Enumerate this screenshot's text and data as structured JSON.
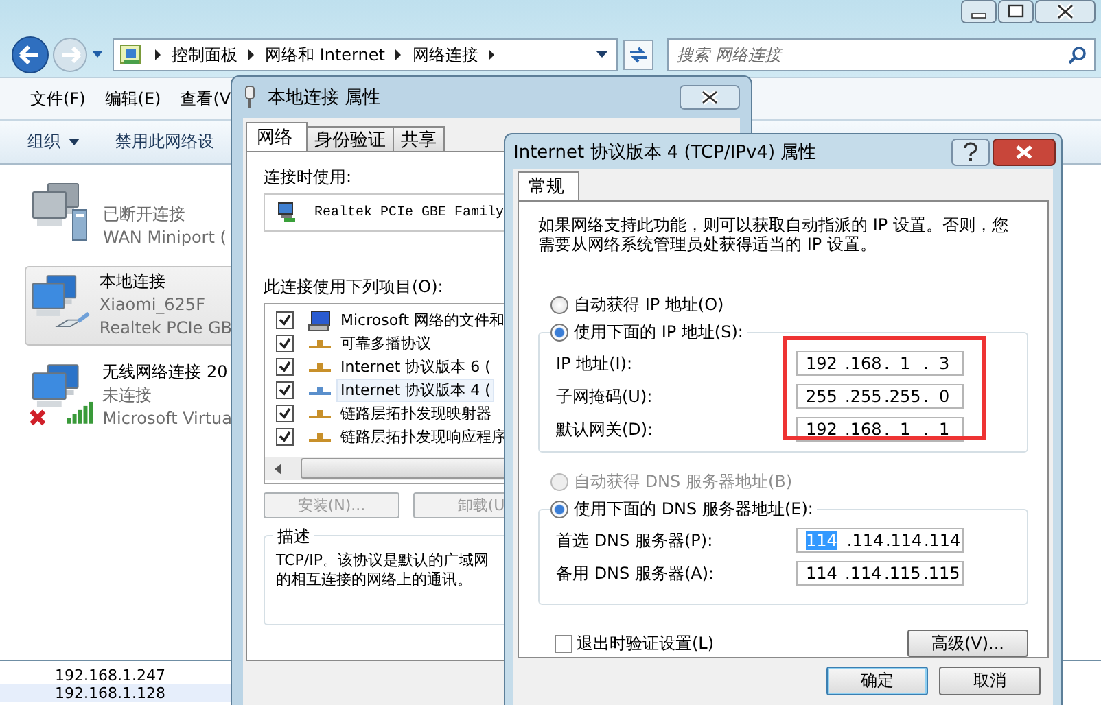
{
  "explorer": {
    "breadcrumb": [
      "控制面板",
      "网络和 Internet",
      "网络连接"
    ],
    "search": {
      "placeholder": "搜索 网络连接"
    },
    "menu": [
      "文件(F)",
      "编辑(E)",
      "查看(V"
    ],
    "toolbar": [
      {
        "label": "组织",
        "dropdown": true
      },
      {
        "label": "禁用此网络设",
        "dropdown": false
      }
    ],
    "connections": [
      {
        "kind": "broadband",
        "selected": false,
        "status": "已断开连接",
        "device": "WAN Miniport ("
      },
      {
        "kind": "ethernet",
        "selected": true,
        "name": "本地连接",
        "status": "Xiaomi_625F",
        "device": "Realtek PCIe GB"
      },
      {
        "kind": "wireless",
        "selected": false,
        "name": "无线网络连接 20",
        "status": "未连接",
        "device": "Microsoft Virtua"
      }
    ]
  },
  "background_list": [
    {
      "text": "192.168.1.247",
      "selected": false
    },
    {
      "text": "192.168.1.128",
      "selected": true
    }
  ],
  "local_dialog": {
    "title": "本地连接 属性",
    "tabs": [
      {
        "label": "网络",
        "selected": true
      },
      {
        "label": "身份验证",
        "selected": false
      },
      {
        "label": "共享",
        "selected": false
      }
    ],
    "connect_using_label": "连接时使用:",
    "adapter": "Realtek PCIe GBE Family",
    "items_label": "此连接使用下列项目(O):",
    "items": [
      {
        "kind": "client",
        "label": "Microsoft 网络的文件和",
        "checked": true,
        "selected": false
      },
      {
        "kind": "protocol",
        "label": "可靠多播协议",
        "checked": true,
        "selected": false
      },
      {
        "kind": "protocol",
        "label": "Internet 协议版本 6 (",
        "checked": true,
        "selected": false
      },
      {
        "kind": "protocol",
        "label": "Internet 协议版本 4 (",
        "checked": true,
        "selected": true
      },
      {
        "kind": "protocol",
        "label": "链路层拓扑发现映射器",
        "checked": true,
        "selected": false
      },
      {
        "kind": "protocol",
        "label": "链路层拓扑发现响应程序",
        "checked": true,
        "selected": false
      }
    ],
    "buttons": [
      {
        "label": "安装(N)...",
        "disabled": true
      },
      {
        "label": "卸载(U",
        "disabled": true
      }
    ],
    "description": {
      "legend": "描述",
      "lines": [
        "TCP/IP。该协议是默认的广域网",
        "的相互连接的网络上的通讯。"
      ]
    }
  },
  "ipv4_dialog": {
    "title": "Internet 协议版本 4 (TCP/IPv4) 属性",
    "tabs": [
      {
        "label": "常规",
        "selected": true
      }
    ],
    "intro": "如果网络支持此功能，则可以获取自动指派的 IP 设置。否则，您需要从网络系统管理员处获得适当的 IP 设置。",
    "ip_mode": [
      {
        "label": "自动获得 IP 地址(O)",
        "selected": false,
        "disabled": false
      },
      {
        "label": "使用下面的 IP 地址(S):",
        "selected": true,
        "disabled": false
      }
    ],
    "ip_fields": [
      {
        "label": "IP 地址(I):",
        "octets": [
          {
            "text": "192",
            "selected": false
          },
          {
            "text": ".168",
            "selected": false
          },
          {
            "text": ".  1",
            "selected": false
          },
          {
            "text": ".  3",
            "selected": false
          }
        ]
      },
      {
        "label": "子网掩码(U):",
        "octets": [
          {
            "text": "255",
            "selected": false
          },
          {
            "text": ".255",
            "selected": false
          },
          {
            "text": ".255",
            "selected": false
          },
          {
            "text": ".  0",
            "selected": false
          }
        ]
      },
      {
        "label": "默认网关(D):",
        "octets": [
          {
            "text": "192",
            "selected": false
          },
          {
            "text": ".168",
            "selected": false
          },
          {
            "text": ".  1",
            "selected": false
          },
          {
            "text": ".  1",
            "selected": false
          }
        ]
      }
    ],
    "highlighted": true,
    "dns_mode": [
      {
        "label": "自动获得 DNS 服务器地址(B)",
        "selected": false,
        "disabled": true
      },
      {
        "label": "使用下面的 DNS 服务器地址(E):",
        "selected": true,
        "disabled": false
      }
    ],
    "dns_fields": [
      {
        "label": "首选 DNS 服务器(P):",
        "octets": [
          {
            "text": "114",
            "selected": true
          },
          {
            "text": ".114",
            "selected": false
          },
          {
            "text": ".114",
            "selected": false
          },
          {
            "text": ".114",
            "selected": false
          }
        ]
      },
      {
        "label": "备用 DNS 服务器(A):",
        "octets": [
          {
            "text": "114",
            "selected": false
          },
          {
            "text": ".114",
            "selected": false
          },
          {
            "text": ".115",
            "selected": false
          },
          {
            "text": ".115",
            "selected": false
          }
        ]
      }
    ],
    "validate_on_exit": {
      "label": "退出时验证设置(L)",
      "checked": false
    },
    "advanced_button": "高级(V)...",
    "buttons": [
      {
        "label": "确定",
        "default": true
      },
      {
        "label": "取消",
        "default": false
      }
    ]
  }
}
